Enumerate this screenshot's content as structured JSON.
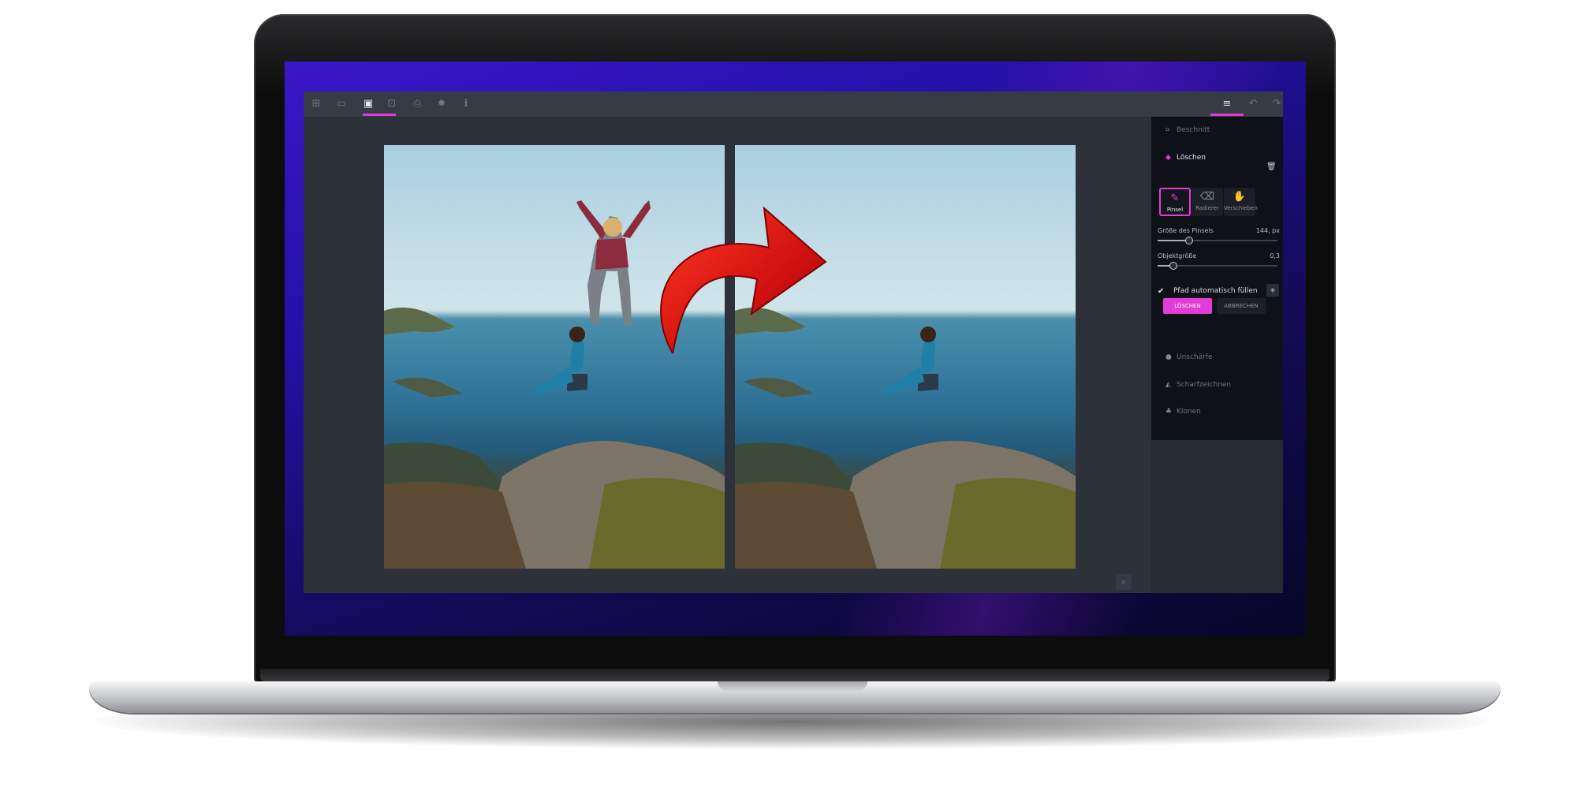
{
  "toolbar": {
    "icons": [
      "add-icon",
      "open-icon",
      "image-icon",
      "export-icon",
      "print-icon",
      "settings-icon",
      "info-icon"
    ],
    "active_icon": "image-icon",
    "right_icons": [
      "adjustments-icon",
      "undo-icon",
      "redo-icon"
    ]
  },
  "accent_color": "#e33bd7",
  "panel": {
    "crop_label": "Beschnitt",
    "erase_label": "Löschen",
    "tools": [
      {
        "label": "Pinsel",
        "icon": "brush-icon",
        "active": true
      },
      {
        "label": "Radierer",
        "icon": "eraser-icon",
        "active": false
      },
      {
        "label": "Verschieben",
        "icon": "hand-icon",
        "active": false
      }
    ],
    "brush_size_label": "Größe des Pinsels",
    "brush_size_value": "144, px",
    "brush_size_fraction": 0.26,
    "object_size_label": "Objektgröße",
    "object_size_value": "0,3",
    "object_size_fraction": 0.13,
    "autofill_label": "Pfad automatisch füllen",
    "autofill_checked": true,
    "primary_button": "LÖSCHEN",
    "secondary_button": "ABBRECHEN",
    "blur_label": "Unschärfe",
    "sharpen_label": "Scharfzeichnen",
    "clone_label": "Klonen"
  }
}
